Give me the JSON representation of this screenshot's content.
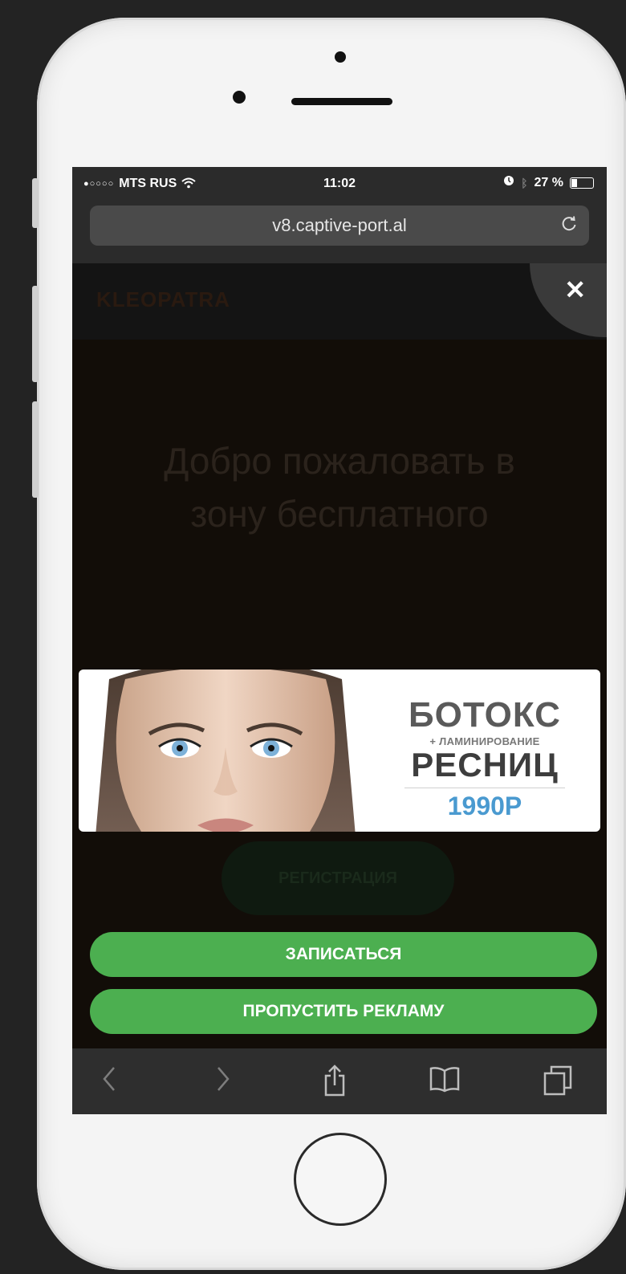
{
  "status_bar": {
    "carrier": "MTS RUS",
    "time": "11:02",
    "battery_text": "27 %",
    "battery_level_pct": 27
  },
  "browser": {
    "url": "v8.captive-port.al"
  },
  "site": {
    "logo": "KLEOPATRA",
    "bg_title": "Добро пожаловать в зону бесплатного",
    "bg_button": "РЕГИСТРАЦИЯ"
  },
  "ad": {
    "title_line1": "БОТОКС",
    "subtitle": "+ ЛАМИНИРОВАНИЕ",
    "title_line2": "РЕСНИЦ",
    "price": "1990Р",
    "accent_color": "#4a9ad0"
  },
  "buttons": {
    "signup": "ЗАПИСАТЬСЯ",
    "skip": "ПРОПУСТИТЬ РЕКЛАМУ",
    "button_color": "#4caf50"
  },
  "toolbar_icons": [
    "back-icon",
    "forward-icon",
    "share-icon",
    "bookmarks-icon",
    "tabs-icon"
  ]
}
